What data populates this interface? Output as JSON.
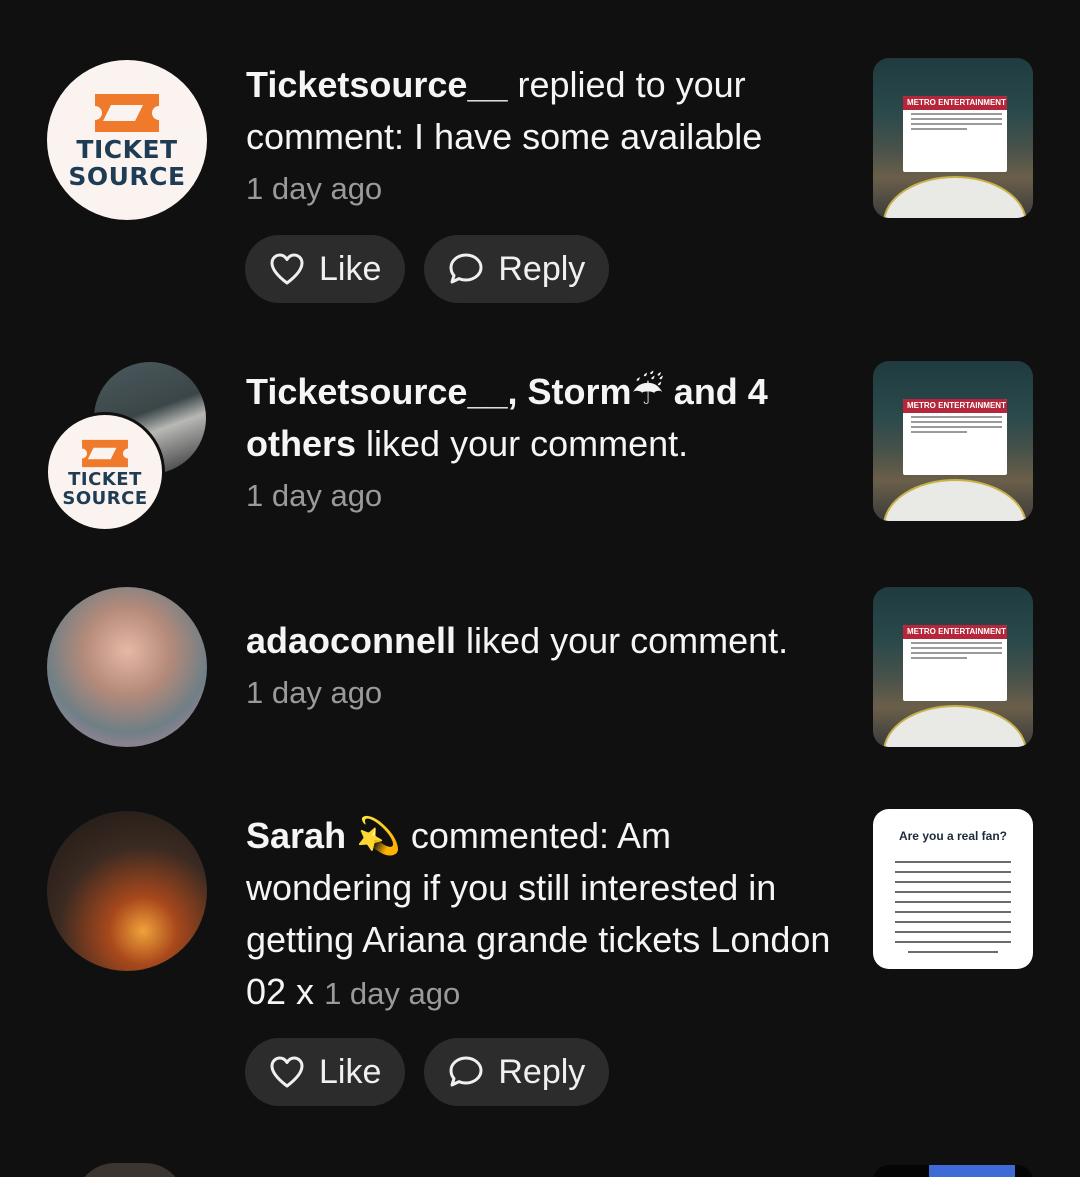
{
  "colors": {
    "background": "#101010",
    "button_bg": "#2c2c2c",
    "text_primary": "#f5f5f5",
    "text_secondary": "#9a9a9a",
    "ticketsource_navy": "#1f3c55",
    "ticketsource_orange": "#f07a2b",
    "metro_red": "#b5263a"
  },
  "notifications": [
    {
      "avatar": {
        "logo_line1": "TICKET",
        "logo_line2": "SOURCE"
      },
      "actor": "Ticketsource__",
      "message": " replied to your comment: I have some available",
      "time": "1 day ago",
      "actions": {
        "like_label": "Like",
        "reply_label": "Reply",
        "like_icon": "heart-icon",
        "reply_icon": "speech-bubble-icon"
      },
      "thumbnail": {
        "header": "METRO ENTERTAINMENT"
      }
    },
    {
      "avatar": {
        "logo_line1": "TICKET",
        "logo_line2": "SOURCE"
      },
      "actors": "Ticketsource__, Storm",
      "emoji": "☔",
      "and_others": " and 4 others",
      "message": " liked your comment.",
      "time": "1 day ago",
      "thumbnail": {
        "header": "METRO ENTERTAINMENT"
      }
    },
    {
      "actor": "adaoconnell",
      "message": " liked your comment.",
      "time": "1 day ago",
      "thumbnail": {
        "header": "METRO ENTERTAINMENT"
      }
    },
    {
      "actor": "Sarah",
      "emoji": "💫",
      "message": " commented: Am wondering if you still interested in getting Ariana grande tickets London 02 x",
      "time": "1 day ago",
      "actions": {
        "like_label": "Like",
        "reply_label": "Reply",
        "like_icon": "heart-icon",
        "reply_icon": "speech-bubble-icon"
      },
      "thumbnail": {
        "title": "Are you a real fan?"
      }
    }
  ]
}
